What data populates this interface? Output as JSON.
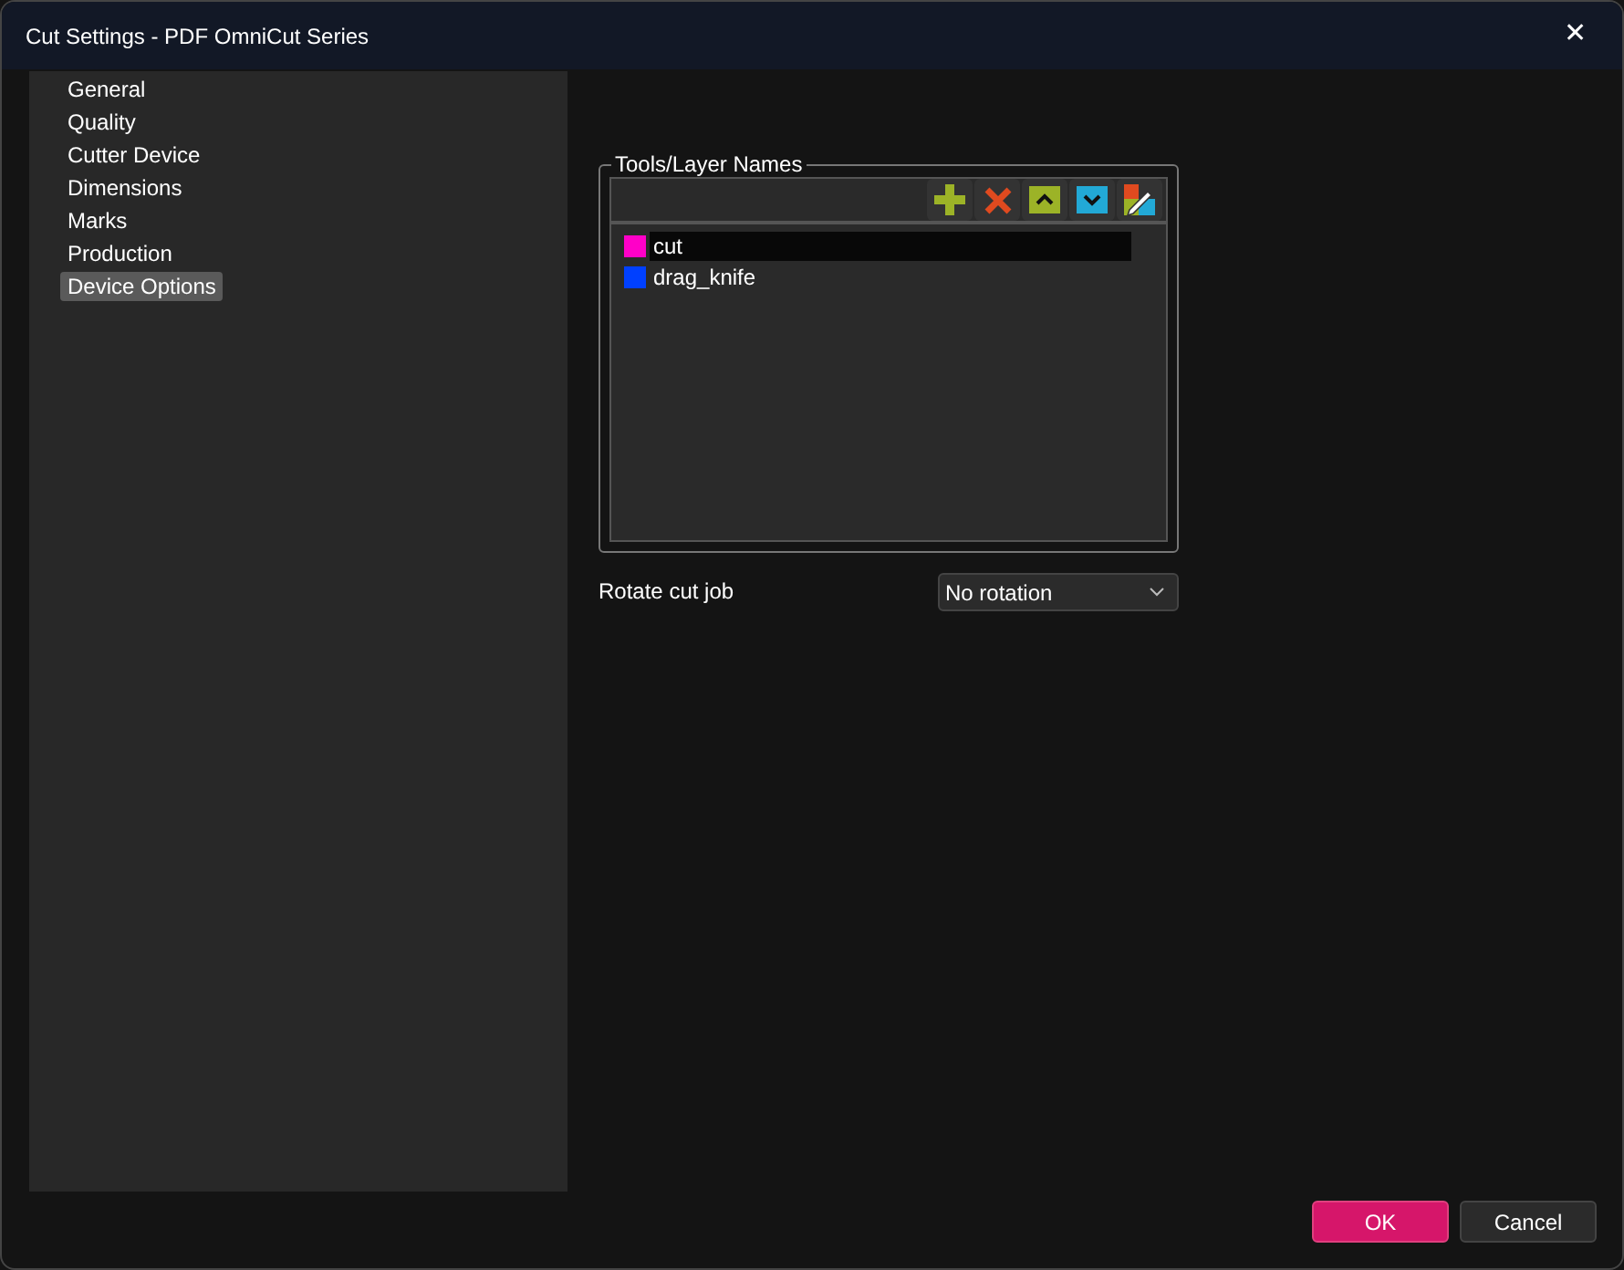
{
  "window": {
    "title": "Cut Settings - PDF OmniCut Series",
    "close": "✕"
  },
  "sidebar": {
    "items": [
      {
        "label": "General",
        "selected": false
      },
      {
        "label": "Quality",
        "selected": false
      },
      {
        "label": "Cutter Device",
        "selected": false
      },
      {
        "label": "Dimensions",
        "selected": false
      },
      {
        "label": "Marks",
        "selected": false
      },
      {
        "label": "Production",
        "selected": false
      },
      {
        "label": "Device Options",
        "selected": true
      }
    ]
  },
  "tools_group": {
    "title": "Tools/Layer Names",
    "layers": [
      {
        "name": "cut",
        "color": "#ff00c8",
        "selected": true
      },
      {
        "name": "drag_knife",
        "color": "#0040ff",
        "selected": false
      }
    ]
  },
  "rotate": {
    "label": "Rotate cut job",
    "value": "No rotation"
  },
  "buttons": [
    {
      "label": "OK",
      "kind": "primary"
    },
    {
      "label": "Cancel",
      "kind": "secondary"
    }
  ]
}
